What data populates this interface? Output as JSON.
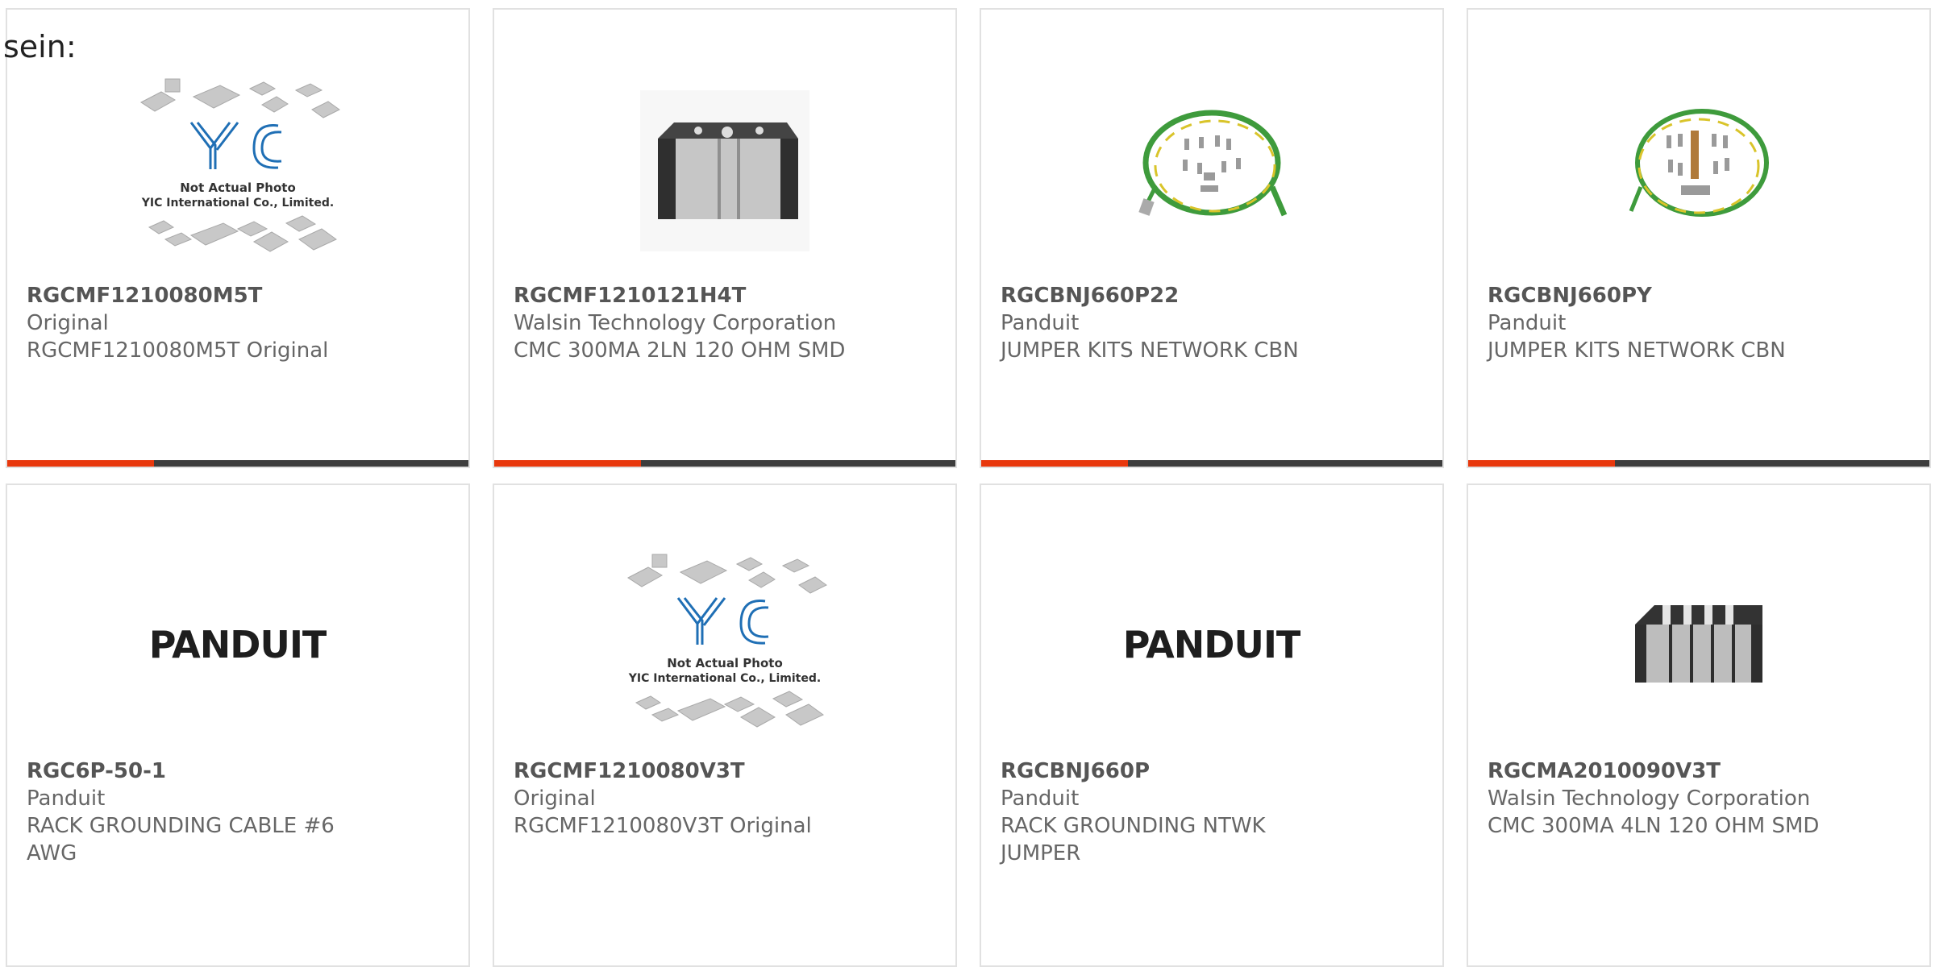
{
  "intro_text": "sein:",
  "colors": {
    "accent": "#e8380d",
    "bar_dark": "#3d3d3d",
    "border": "#e1e1e1",
    "text": "#666666",
    "yic_blue": "#1f6fb5",
    "cable_green": "#3e9b3c",
    "cable_yellow": "#d9c42a"
  },
  "products": [
    {
      "part_number": "RGCMF1210080M5T",
      "manufacturer": "Original",
      "description": "RGCMF1210080M5T Original",
      "image": "yic-not-actual-photo",
      "image_caption_line1": "Not Actual Photo",
      "image_caption_line2": "YIC International Co., Limited.",
      "logo_text": "YIC"
    },
    {
      "part_number": "RGCMF1210121H4T",
      "manufacturer": "Walsin Technology Corporation",
      "description": "CMC 300MA 2LN 120 OHM SMD",
      "image": "common-mode-choke-2ln"
    },
    {
      "part_number": "RGCBNJ660P22",
      "manufacturer": "Panduit",
      "description": "JUMPER KITS NETWORK CBN",
      "image": "grounding-cable-kit"
    },
    {
      "part_number": "RGCBNJ660PY",
      "manufacturer": "Panduit",
      "description": "JUMPER KITS NETWORK CBN",
      "image": "grounding-cable-kit"
    },
    {
      "part_number": "RGC6P-50-1",
      "manufacturer": "Panduit",
      "description_line1": "RACK GROUNDING CABLE #6",
      "description_line2": "AWG",
      "image": "panduit-logo",
      "logo_text": "PANDUIT"
    },
    {
      "part_number": "RGCMF1210080V3T",
      "manufacturer": "Original",
      "description": "RGCMF1210080V3T Original",
      "image": "yic-not-actual-photo",
      "image_caption_line1": "Not Actual Photo",
      "image_caption_line2": "YIC International Co., Limited.",
      "logo_text": "YIC"
    },
    {
      "part_number": "RGCBNJ660P",
      "manufacturer": "Panduit",
      "description_line1": "RACK GROUNDING NTWK",
      "description_line2": "JUMPER",
      "image": "panduit-logo",
      "logo_text": "PANDUIT"
    },
    {
      "part_number": "RGCMA2010090V3T",
      "manufacturer": "Walsin Technology Corporation",
      "description": "CMC 300MA 4LN 120 OHM SMD",
      "image": "common-mode-choke-4ln"
    }
  ]
}
